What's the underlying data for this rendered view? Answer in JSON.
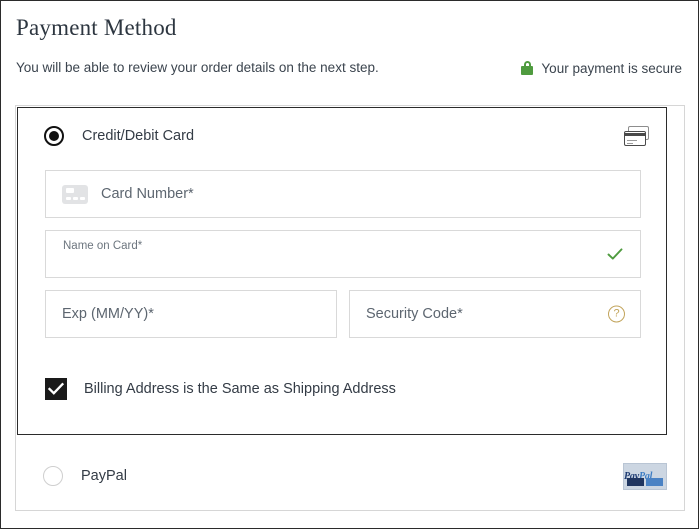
{
  "header": {
    "title": "Payment Method",
    "subtitle": "You will be able to review your order details on the next step.",
    "secure_text": "Your payment is secure",
    "lock_icon": "lock-icon",
    "secure_color": "#4f9b3f"
  },
  "payment_methods": [
    {
      "id": "credit-debit-card",
      "label": "Credit/Debit Card",
      "selected": true,
      "badge_icon": "credit-cards-icon"
    },
    {
      "id": "paypal",
      "label": "PayPal",
      "selected": false,
      "badge_icon": "paypal-logo",
      "logo_text_primary": "Pay",
      "logo_text_secondary": "Pal"
    }
  ],
  "card_form": {
    "card_number": {
      "placeholder": "Card Number*",
      "value": "",
      "icon": "card-icon"
    },
    "name_on_card": {
      "label": "Name on Card*",
      "value": "",
      "valid_icon": "check-icon",
      "valid_color": "#4f9b3f"
    },
    "expiry": {
      "placeholder": "Exp (MM/YY)*",
      "value": ""
    },
    "security_code": {
      "placeholder": "Security Code*",
      "value": "",
      "help_icon": "question-circle-icon",
      "help_icon_color": "#c2a45b"
    },
    "billing_same_as_shipping": {
      "label": "Billing Address is the Same as Shipping Address",
      "checked": true
    }
  }
}
